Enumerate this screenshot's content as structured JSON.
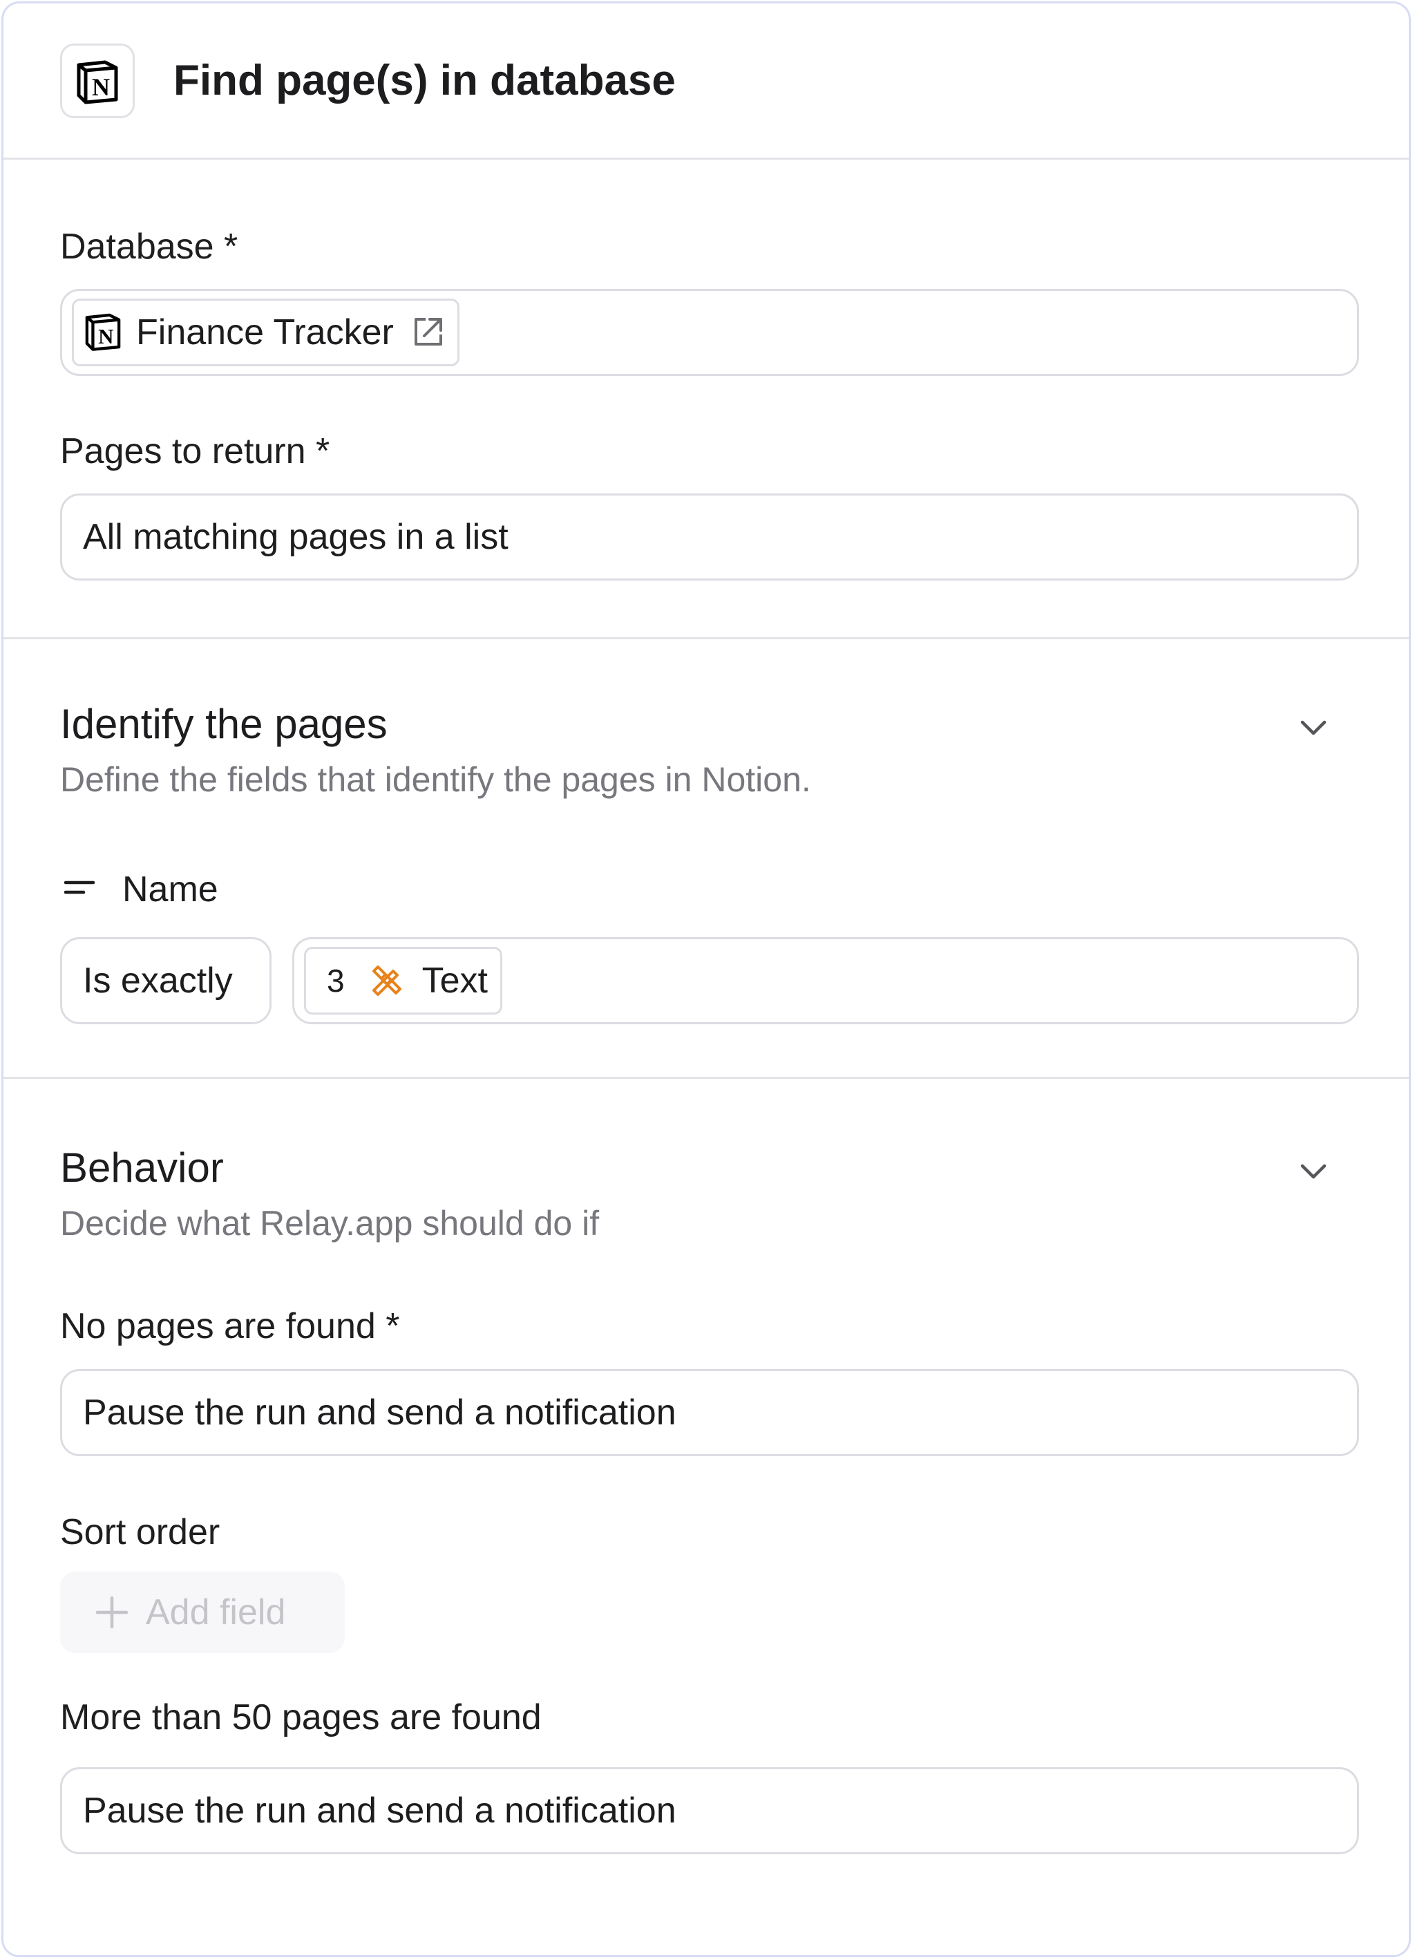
{
  "header": {
    "title": "Find page(s) in database",
    "logo_icon": "notion-logo-icon"
  },
  "database": {
    "label": "Database *",
    "value": "Finance Tracker",
    "icon": "notion-logo-icon",
    "link_icon": "external-link-icon"
  },
  "pages_to_return": {
    "label": "Pages to return *",
    "value": "All matching pages in a list"
  },
  "identify": {
    "title": "Identify the pages",
    "description": "Define the fields that identify the pages in Notion.",
    "property": {
      "icon": "text-property-icon",
      "label": "Name"
    },
    "operator": "Is exactly",
    "token": {
      "step": "3",
      "icon": "step-tools-icon",
      "label": "Text"
    }
  },
  "behavior": {
    "title": "Behavior",
    "description": "Decide what Relay.app should do if",
    "no_pages": {
      "label": "No pages are found *",
      "value": "Pause the run and send a notification"
    },
    "sort_order": {
      "label": "Sort order",
      "add_label": "Add field"
    },
    "more_than": {
      "label": "More than 50 pages are found",
      "value": "Pause the run and send a notification"
    }
  },
  "colors": {
    "border": "#d6dcf3",
    "accent_orange": "#e8821a",
    "muted_text": "#77777d"
  }
}
